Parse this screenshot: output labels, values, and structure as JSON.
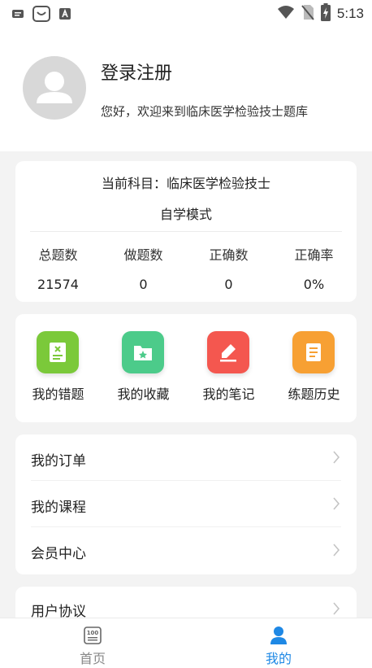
{
  "status_bar": {
    "time": "5:13",
    "icons_left": [
      "notification-icon",
      "shopping-icon",
      "app-icon"
    ],
    "icons_right": [
      "wifi-icon",
      "no-sim-icon",
      "battery-charging-icon"
    ]
  },
  "profile": {
    "login_label": "登录注册",
    "welcome_text": "您好，欢迎来到临床医学检验技士题库"
  },
  "stats": {
    "subject": "当前科目：临床医学检验技士",
    "mode": "自学模式",
    "items": [
      {
        "label": "总题数",
        "value": "21574"
      },
      {
        "label": "做题数",
        "value": "0"
      },
      {
        "label": "正确数",
        "value": "0"
      },
      {
        "label": "正确率",
        "value": "0%"
      }
    ]
  },
  "features": [
    {
      "label": "我的错题",
      "icon": "wrong-questions-icon",
      "color": "#7bc93a"
    },
    {
      "label": "我的收藏",
      "icon": "favorites-folder-icon",
      "color": "#4ccb8a"
    },
    {
      "label": "我的笔记",
      "icon": "notes-pen-icon",
      "color": "#f4574f"
    },
    {
      "label": "练题历史",
      "icon": "history-scroll-icon",
      "color": "#f7a033"
    }
  ],
  "menu": [
    {
      "label": "我的订单"
    },
    {
      "label": "我的课程"
    },
    {
      "label": "会员中心"
    },
    {
      "label": "用户协议"
    }
  ],
  "bottom_nav": [
    {
      "label": "首页",
      "icon": "home-exam-icon",
      "active": false
    },
    {
      "label": "我的",
      "icon": "profile-person-icon",
      "active": true
    }
  ],
  "colors": {
    "accent": "#1e88e5",
    "inactive_nav": "#888888"
  }
}
